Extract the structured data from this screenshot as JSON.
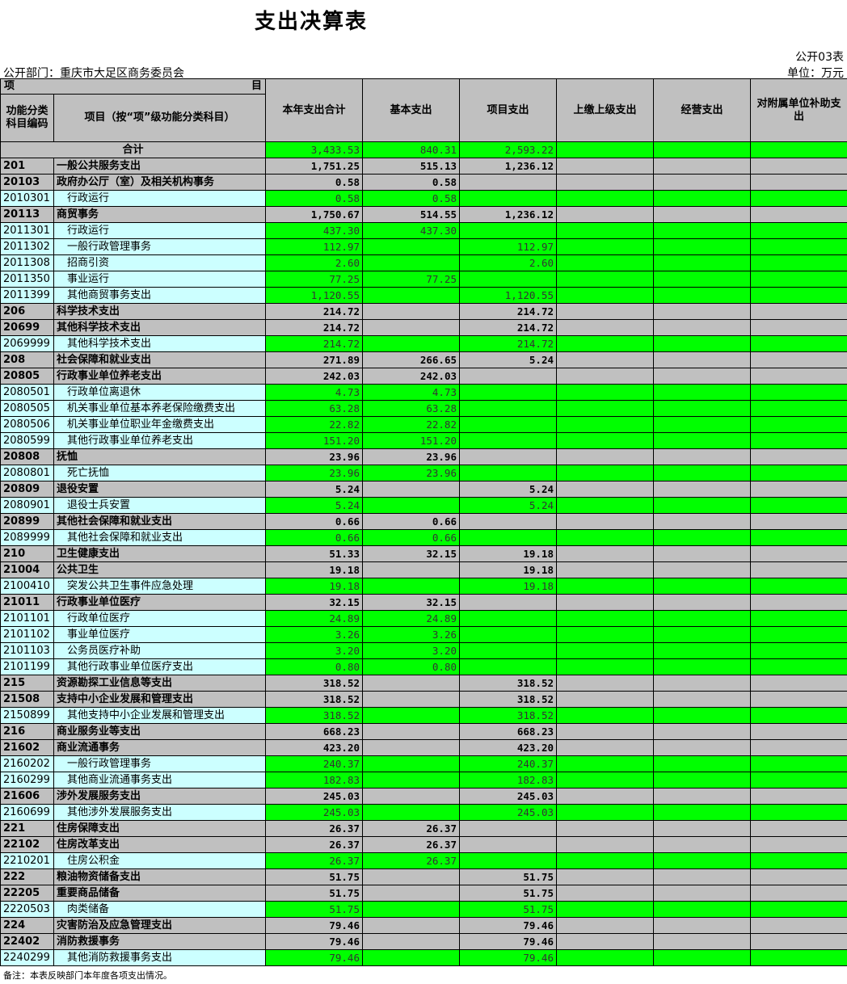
{
  "title": "支出决算表",
  "form_code": "公开03表",
  "department": "公开部门：重庆市大足区商务委员会",
  "unit": "单位：万元",
  "header": {
    "item_left": "项",
    "item_right": "目",
    "code_col": "功能分类科目编码",
    "name_col": "项目（按“项”级功能分类科目）",
    "col_total": "本年支出合计",
    "col_basic": "基本支出",
    "col_project": "项目支出",
    "col_upper": "上缴上级支出",
    "col_business": "经营支出",
    "col_subsidy": "对附属单位补助支出"
  },
  "total_row": {
    "label": "合计",
    "total": "3,433.53",
    "basic": "840.31",
    "project": "2,593.22"
  },
  "rows": [
    {
      "level": "gray",
      "code": "201",
      "name": "一般公共服务支出",
      "total": "1,751.25",
      "basic": "515.13",
      "project": "1,236.12"
    },
    {
      "level": "gray",
      "code": "20103",
      "name": "政府办公厅（室）及相关机构事务",
      "total": "0.58",
      "basic": "0.58",
      "project": ""
    },
    {
      "level": "green",
      "code": "2010301",
      "name": "行政运行",
      "total": "0.58",
      "basic": "0.58",
      "project": ""
    },
    {
      "level": "gray",
      "code": "20113",
      "name": "商贸事务",
      "total": "1,750.67",
      "basic": "514.55",
      "project": "1,236.12"
    },
    {
      "level": "green",
      "code": "2011301",
      "name": "行政运行",
      "total": "437.30",
      "basic": "437.30",
      "project": ""
    },
    {
      "level": "green",
      "code": "2011302",
      "name": "一般行政管理事务",
      "total": "112.97",
      "basic": "",
      "project": "112.97"
    },
    {
      "level": "green",
      "code": "2011308",
      "name": "招商引资",
      "total": "2.60",
      "basic": "",
      "project": "2.60"
    },
    {
      "level": "green",
      "code": "2011350",
      "name": "事业运行",
      "total": "77.25",
      "basic": "77.25",
      "project": ""
    },
    {
      "level": "green",
      "code": "2011399",
      "name": "其他商贸事务支出",
      "total": "1,120.55",
      "basic": "",
      "project": "1,120.55"
    },
    {
      "level": "gray",
      "code": "206",
      "name": "科学技术支出",
      "total": "214.72",
      "basic": "",
      "project": "214.72"
    },
    {
      "level": "gray",
      "code": "20699",
      "name": "其他科学技术支出",
      "total": "214.72",
      "basic": "",
      "project": "214.72"
    },
    {
      "level": "green",
      "code": "2069999",
      "name": "其他科学技术支出",
      "total": "214.72",
      "basic": "",
      "project": "214.72"
    },
    {
      "level": "gray",
      "code": "208",
      "name": "社会保障和就业支出",
      "total": "271.89",
      "basic": "266.65",
      "project": "5.24"
    },
    {
      "level": "gray",
      "code": "20805",
      "name": "行政事业单位养老支出",
      "total": "242.03",
      "basic": "242.03",
      "project": ""
    },
    {
      "level": "green",
      "code": "2080501",
      "name": "行政单位离退休",
      "total": "4.73",
      "basic": "4.73",
      "project": ""
    },
    {
      "level": "green",
      "code": "2080505",
      "name": "机关事业单位基本养老保险缴费支出",
      "total": "63.28",
      "basic": "63.28",
      "project": ""
    },
    {
      "level": "green",
      "code": "2080506",
      "name": "机关事业单位职业年金缴费支出",
      "total": "22.82",
      "basic": "22.82",
      "project": ""
    },
    {
      "level": "green",
      "code": "2080599",
      "name": "其他行政事业单位养老支出",
      "total": "151.20",
      "basic": "151.20",
      "project": ""
    },
    {
      "level": "gray",
      "code": "20808",
      "name": "抚恤",
      "total": "23.96",
      "basic": "23.96",
      "project": ""
    },
    {
      "level": "green",
      "code": "2080801",
      "name": "死亡抚恤",
      "total": "23.96",
      "basic": "23.96",
      "project": ""
    },
    {
      "level": "gray",
      "code": "20809",
      "name": "退役安置",
      "total": "5.24",
      "basic": "",
      "project": "5.24"
    },
    {
      "level": "green",
      "code": "2080901",
      "name": "退役士兵安置",
      "total": "5.24",
      "basic": "",
      "project": "5.24"
    },
    {
      "level": "gray",
      "code": "20899",
      "name": "其他社会保障和就业支出",
      "total": "0.66",
      "basic": "0.66",
      "project": ""
    },
    {
      "level": "green",
      "code": "2089999",
      "name": "其他社会保障和就业支出",
      "total": "0.66",
      "basic": "0.66",
      "project": ""
    },
    {
      "level": "gray",
      "code": "210",
      "name": "卫生健康支出",
      "total": "51.33",
      "basic": "32.15",
      "project": "19.18"
    },
    {
      "level": "gray",
      "code": "21004",
      "name": "公共卫生",
      "total": "19.18",
      "basic": "",
      "project": "19.18"
    },
    {
      "level": "green",
      "code": "2100410",
      "name": "突发公共卫生事件应急处理",
      "total": "19.18",
      "basic": "",
      "project": "19.18"
    },
    {
      "level": "gray",
      "code": "21011",
      "name": "行政事业单位医疗",
      "total": "32.15",
      "basic": "32.15",
      "project": ""
    },
    {
      "level": "green",
      "code": "2101101",
      "name": "行政单位医疗",
      "total": "24.89",
      "basic": "24.89",
      "project": ""
    },
    {
      "level": "green",
      "code": "2101102",
      "name": "事业单位医疗",
      "total": "3.26",
      "basic": "3.26",
      "project": ""
    },
    {
      "level": "green",
      "code": "2101103",
      "name": "公务员医疗补助",
      "total": "3.20",
      "basic": "3.20",
      "project": ""
    },
    {
      "level": "green",
      "code": "2101199",
      "name": "其他行政事业单位医疗支出",
      "total": "0.80",
      "basic": "0.80",
      "project": ""
    },
    {
      "level": "gray",
      "code": "215",
      "name": "资源勘探工业信息等支出",
      "total": "318.52",
      "basic": "",
      "project": "318.52"
    },
    {
      "level": "gray",
      "code": "21508",
      "name": "支持中小企业发展和管理支出",
      "total": "318.52",
      "basic": "",
      "project": "318.52"
    },
    {
      "level": "green",
      "code": "2150899",
      "name": "其他支持中小企业发展和管理支出",
      "total": "318.52",
      "basic": "",
      "project": "318.52"
    },
    {
      "level": "gray",
      "code": "216",
      "name": "商业服务业等支出",
      "total": "668.23",
      "basic": "",
      "project": "668.23"
    },
    {
      "level": "gray",
      "code": "21602",
      "name": "商业流通事务",
      "total": "423.20",
      "basic": "",
      "project": "423.20"
    },
    {
      "level": "green",
      "code": "2160202",
      "name": "一般行政管理事务",
      "total": "240.37",
      "basic": "",
      "project": "240.37"
    },
    {
      "level": "green",
      "code": "2160299",
      "name": "其他商业流通事务支出",
      "total": "182.83",
      "basic": "",
      "project": "182.83"
    },
    {
      "level": "gray",
      "code": "21606",
      "name": "涉外发展服务支出",
      "total": "245.03",
      "basic": "",
      "project": "245.03"
    },
    {
      "level": "green",
      "code": "2160699",
      "name": "其他涉外发展服务支出",
      "total": "245.03",
      "basic": "",
      "project": "245.03"
    },
    {
      "level": "gray",
      "code": "221",
      "name": "住房保障支出",
      "total": "26.37",
      "basic": "26.37",
      "project": ""
    },
    {
      "level": "gray",
      "code": "22102",
      "name": "住房改革支出",
      "total": "26.37",
      "basic": "26.37",
      "project": ""
    },
    {
      "level": "green",
      "code": "2210201",
      "name": "住房公积金",
      "total": "26.37",
      "basic": "26.37",
      "project": ""
    },
    {
      "level": "gray",
      "code": "222",
      "name": "粮油物资储备支出",
      "total": "51.75",
      "basic": "",
      "project": "51.75"
    },
    {
      "level": "gray",
      "code": "22205",
      "name": "重要商品储备",
      "total": "51.75",
      "basic": "",
      "project": "51.75"
    },
    {
      "level": "green",
      "code": "2220503",
      "name": "肉类储备",
      "total": "51.75",
      "basic": "",
      "project": "51.75"
    },
    {
      "level": "gray",
      "code": "224",
      "name": "灾害防治及应急管理支出",
      "total": "79.46",
      "basic": "",
      "project": "79.46"
    },
    {
      "level": "gray",
      "code": "22402",
      "name": "消防救援事务",
      "total": "79.46",
      "basic": "",
      "project": "79.46"
    },
    {
      "level": "green",
      "code": "2240299",
      "name": "其他消防救援事务支出",
      "total": "79.46",
      "basic": "",
      "project": "79.46"
    }
  ],
  "note": "备注：本表反映部门本年度各项支出情况。"
}
